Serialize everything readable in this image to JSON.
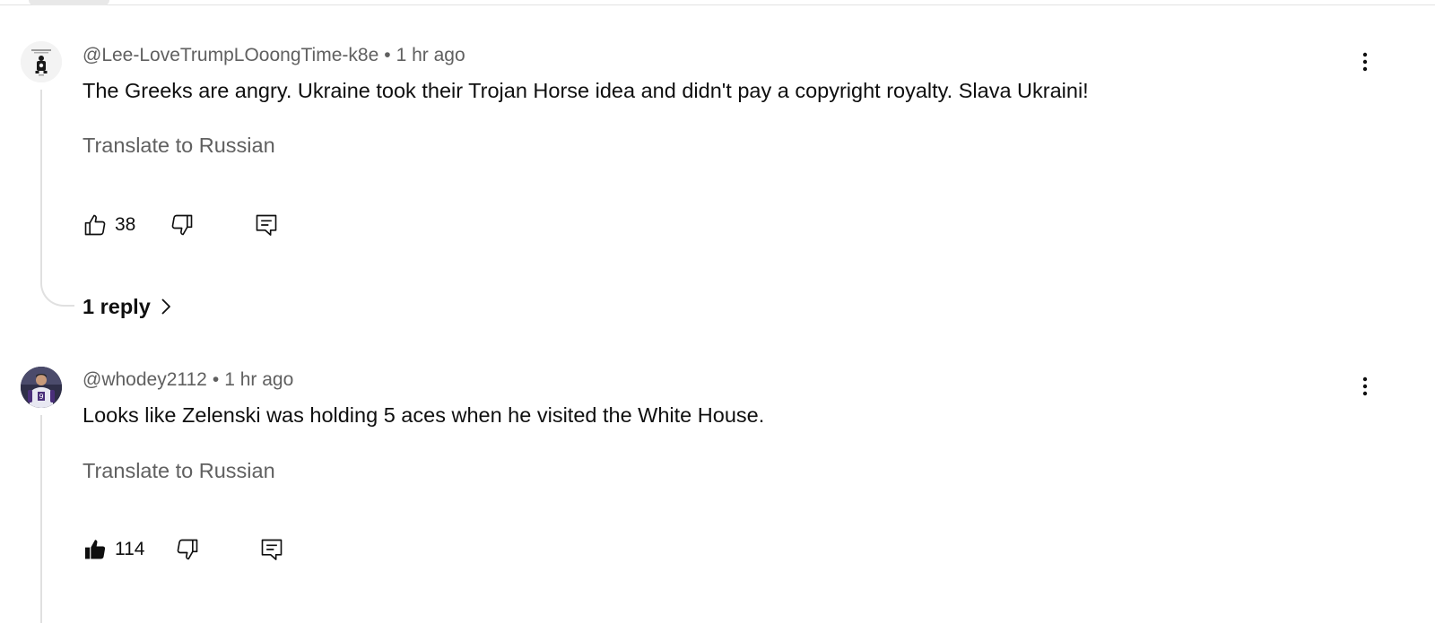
{
  "comments": [
    {
      "handle": "@Lee-LoveTrumpLOoongTime-k8e",
      "time": "1 hr ago",
      "text": "The Greeks are angry.  Ukraine took their Trojan Horse idea and didn't pay a copyright royalty.  Slava Ukraini!",
      "translate": "Translate to Russian",
      "likes": "38",
      "liked": false,
      "replies": "1 reply",
      "avatar_icon": "person-silhouette-avatar"
    },
    {
      "handle": "@whodey2112",
      "time": "1 hr ago",
      "text": "Looks like Zelenski was holding 5 aces when he visited the White House.",
      "translate": "Translate to Russian",
      "likes": "114",
      "liked": true,
      "avatar_icon": "football-player-avatar"
    }
  ],
  "separator": "•",
  "icons": {
    "like": "thumbs-up-icon",
    "dislike": "thumbs-down-icon",
    "reply": "reply-comment-icon",
    "more": "three-dots-vertical-icon",
    "expand": "chevron-right-icon"
  },
  "colors": {
    "text_primary": "#0f0f0f",
    "text_secondary": "#606060",
    "thread_line": "#e0e0e0"
  }
}
